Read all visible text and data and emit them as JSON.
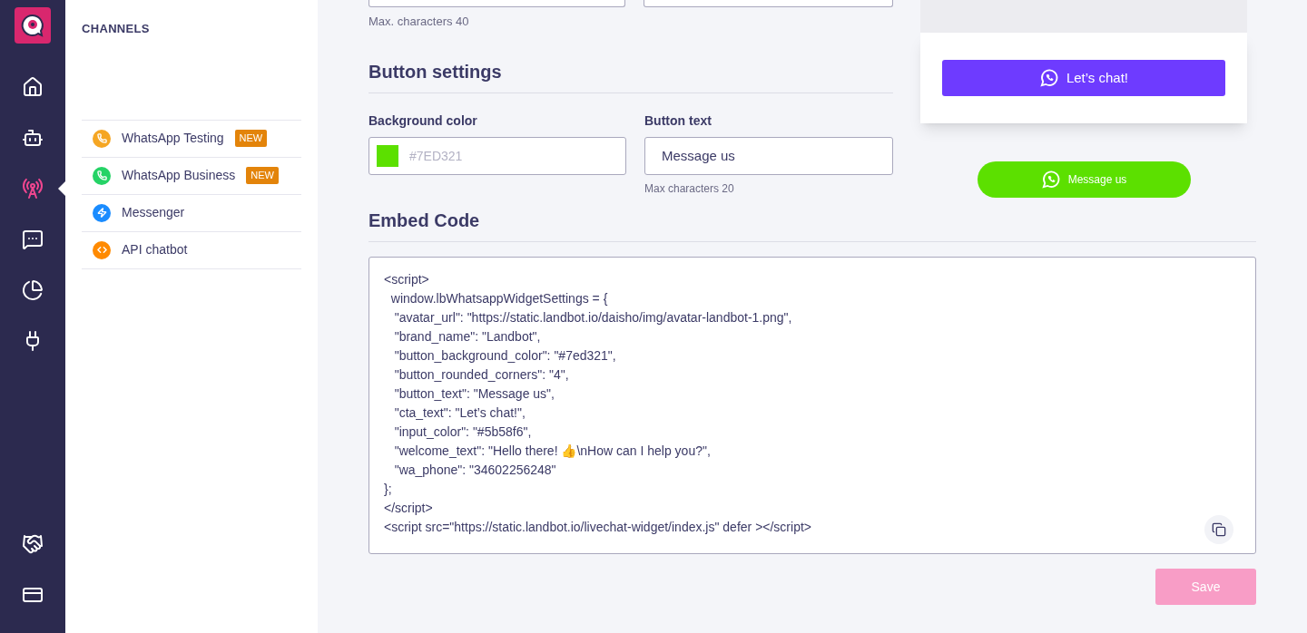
{
  "nav": {
    "top": [
      {
        "kind": "home",
        "selected": false
      },
      {
        "kind": "bot",
        "selected": false
      },
      {
        "kind": "channels",
        "selected": true
      },
      {
        "kind": "chat",
        "selected": false
      },
      {
        "kind": "analytics",
        "selected": false
      },
      {
        "kind": "integrations",
        "selected": false
      }
    ],
    "bottom": [
      {
        "kind": "partners",
        "selected": false
      },
      {
        "kind": "billing",
        "selected": false
      }
    ]
  },
  "channels_panel": {
    "title": "CHANNELS",
    "items": [
      {
        "label": "WhatsApp Testing",
        "badge": "NEW",
        "kind": "whatsapp",
        "color": "#f5a623"
      },
      {
        "label": "WhatsApp Business",
        "badge": "NEW",
        "kind": "whatsapp",
        "color": "#25d366"
      },
      {
        "label": "Messenger",
        "kind": "messenger",
        "color": "#1a8cff"
      },
      {
        "label": "API chatbot",
        "kind": "api",
        "color": "#ff8a00"
      }
    ]
  },
  "top_hint": "Max. characters 40",
  "button_settings": {
    "title": "Button settings",
    "background_color": {
      "label": "Background color",
      "placeholder": "#7ED321"
    },
    "button_text": {
      "label": "Button text",
      "value": "Message us",
      "hint": "Max characters 20"
    }
  },
  "preview": {
    "cta_button": "Let’s chat!",
    "message_button": "Message us"
  },
  "embed": {
    "title": "Embed Code",
    "lines": [
      "<script>",
      "  window.lbWhatsappWidgetSettings = {",
      "   \"avatar_url\": \"https://static.landbot.io/daisho/img/avatar-landbot-1.png\",",
      "   \"brand_name\": \"Landbot\",",
      "   \"button_background_color\": \"#7ed321\",",
      "   \"button_rounded_corners\": \"4\",",
      "   \"button_text\": \"Message us\",",
      "   \"cta_text\": \"Let’s chat!\",",
      "   \"input_color\": \"#5b58f6\",",
      "   \"welcome_text\": \"Hello there! 👍\\nHow can I help you?\",",
      "   \"wa_phone\": \"34602256248\"",
      "};",
      "</script>",
      "<script src=\"https://static.landbot.io/livechat-widget/index.js\" defer ></script>"
    ]
  },
  "save": {
    "label": "Save",
    "disabled": true
  }
}
